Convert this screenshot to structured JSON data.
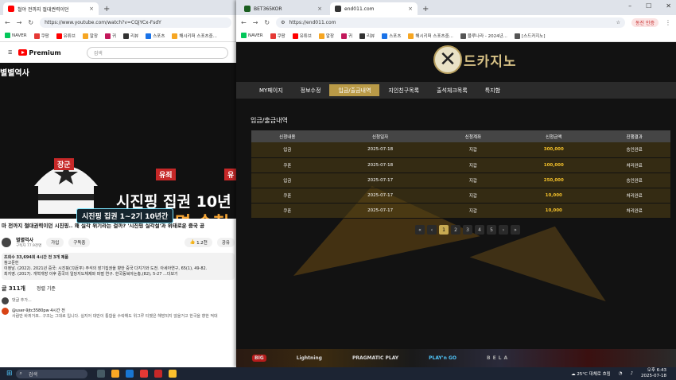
{
  "left_browser": {
    "tab_title": "철야 전까지 절대권력이던",
    "url": "https://www.youtube.com/watch?v=CQjYCx-FsdY",
    "bookmarks": [
      "NAVER",
      "쿠팡",
      "유튜브",
      "알장",
      "귀",
      "리뷰",
      "스포츠",
      "해시키퍼 스포츠중..."
    ],
    "youtube": {
      "premium_label": "Premium",
      "search_placeholder": "검색",
      "video": {
        "channel_overlay": "별별역사",
        "badge_left": "유죄",
        "badge_right": "유",
        "headline1": "시진핑 집권 10년",
        "headline2": "약 160명 숙청",
        "rank_label": "장군",
        "banner": "시진핑 집권 1~2기 10년간"
      },
      "title": "마 전까지 절대권력이던 시진핑.. 왜 실각 위기라는 걸까? '시진핑 실각설'과 위태로운 중국 공",
      "channel": "별별역사",
      "subs": "구독자 77.9천명",
      "join_label": "가입",
      "subscribe_label": "구독중",
      "likes": "1.2천",
      "share_label": "공유",
      "desc_line1": "조회수 33,694회  4시간 전  3개 제품",
      "desc_line2": "참고문헌",
      "desc_line3": "이정남. (2022). 2021년 중국: 시진핑(习近平) 주석의 장기집권을 향한 중국 다지기와 도전. 아세아연구, 65(1), 49-82.",
      "desc_line4": "최지영. (2017). 개혁개방 이후 중국의 일당지도체제와 파벌 연구. 한국동북아논총,(82), 5-27 ...더보기",
      "comments_count": "글 311개",
      "sort_label": "정렬 기준",
      "add_comment": "댓글 추가...",
      "first_comment_user": "@user-9jtc3580pw 4시간 전",
      "first_comment_text": "사람만 바뀌거죠.. 구조는 그대로 입니다. 실지어 대만이 통합을 수락해도 위그루 티벳은 해방되지 않을거고 한국을 향한 적대"
    }
  },
  "right_browser": {
    "tab1": "BET365KOR",
    "tab2": "end011.com",
    "url": "https://end011.com",
    "profile_label": "동진 인증",
    "bookmarks": [
      "NAVER",
      "쿠팡",
      "유튜브",
      "알장",
      "귀",
      "리뷰",
      "스포츠",
      "해시키퍼 스포츠중...",
      "블루나라 - 2024년...",
      "[스드카지노]"
    ],
    "site": {
      "logo_text": "드카지노",
      "nav": [
        "MY페이지",
        "정보수정",
        "입금/출금내역",
        "지인친구목록",
        "출석체크목록",
        "특지함"
      ],
      "active_nav": 2,
      "page_title": "입금/출금내역",
      "table_headers": [
        "신청내용",
        "신청일자",
        "신청계좌",
        "신청금액",
        "진행결과"
      ],
      "rows": [
        [
          "입금",
          "2025-07-18",
          "지갑",
          "300,000",
          "승인완료"
        ],
        [
          "쿠폰",
          "2025-07-18",
          "지갑",
          "100,000",
          "처리완료"
        ],
        [
          "입금",
          "2025-07-17",
          "지갑",
          "250,000",
          "승인완료"
        ],
        [
          "쿠폰",
          "2025-07-17",
          "지갑",
          "10,000",
          "처리완료"
        ],
        [
          "쿠폰",
          "2025-07-17",
          "지갑",
          "10,000",
          "처리완료"
        ]
      ],
      "pager": [
        "«",
        "‹",
        "1",
        "2",
        "3",
        "4",
        "5",
        "›",
        "»"
      ],
      "current_page": "1",
      "providers": [
        "BIG",
        "Lightning",
        "PRAGMATIC PLAY",
        "PLAY'n GO",
        "BELA"
      ]
    }
  },
  "taskbar": {
    "search": "검색",
    "weather": "25°C 대체로 흐림",
    "time": "오후 6:43",
    "date": "2025-07-18"
  }
}
